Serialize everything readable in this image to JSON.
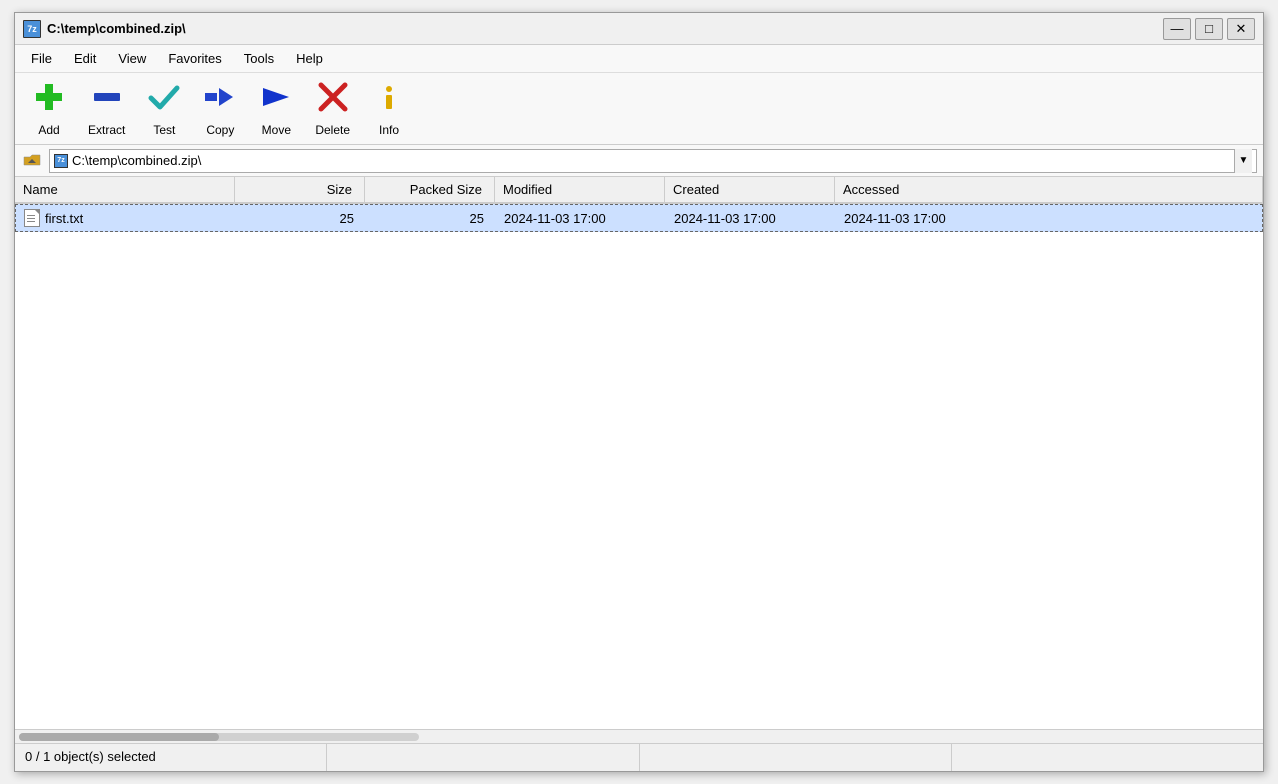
{
  "window": {
    "title": "C:\\temp\\combined.zip\\",
    "title_icon": "7z",
    "minimize_label": "—",
    "restore_label": "□",
    "close_label": "✕"
  },
  "menubar": {
    "items": [
      {
        "id": "file",
        "label": "File"
      },
      {
        "id": "edit",
        "label": "Edit"
      },
      {
        "id": "view",
        "label": "View"
      },
      {
        "id": "favorites",
        "label": "Favorites"
      },
      {
        "id": "tools",
        "label": "Tools"
      },
      {
        "id": "help",
        "label": "Help"
      }
    ]
  },
  "toolbar": {
    "buttons": [
      {
        "id": "add",
        "label": "Add"
      },
      {
        "id": "extract",
        "label": "Extract"
      },
      {
        "id": "test",
        "label": "Test"
      },
      {
        "id": "copy",
        "label": "Copy"
      },
      {
        "id": "move",
        "label": "Move"
      },
      {
        "id": "delete",
        "label": "Delete"
      },
      {
        "id": "info",
        "label": "Info"
      }
    ]
  },
  "address": {
    "path": "C:\\temp\\combined.zip\\",
    "icon": "7z"
  },
  "columns": [
    {
      "id": "name",
      "label": "Name"
    },
    {
      "id": "size",
      "label": "Size"
    },
    {
      "id": "packed_size",
      "label": "Packed Size"
    },
    {
      "id": "modified",
      "label": "Modified"
    },
    {
      "id": "created",
      "label": "Created"
    },
    {
      "id": "accessed",
      "label": "Accessed"
    }
  ],
  "files": [
    {
      "name": "first.txt",
      "size": "25",
      "packed_size": "25",
      "modified": "2024-11-03 17:00",
      "created": "2024-11-03 17:00",
      "accessed": "2024-11-03 17:00",
      "selected": true
    }
  ],
  "statusbar": {
    "segments": [
      {
        "id": "selection",
        "label": "0 / 1 object(s) selected"
      },
      {
        "id": "seg2",
        "label": ""
      },
      {
        "id": "seg3",
        "label": ""
      },
      {
        "id": "seg4",
        "label": ""
      }
    ]
  }
}
